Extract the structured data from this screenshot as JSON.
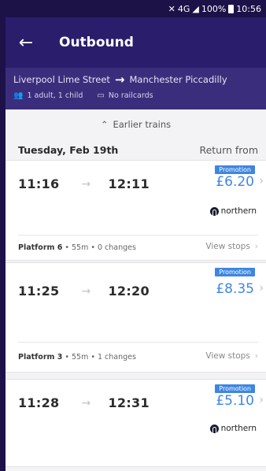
{
  "status_bar": {
    "signal": "4G",
    "battery": "100%",
    "time": "10:56"
  },
  "header": {
    "title": "Outbound"
  },
  "journey": {
    "origin": "Liverpool Lime Street",
    "destination": "Manchester Piccadilly",
    "passengers": "1 adult, 1 child",
    "railcards": "No railcards"
  },
  "earlier_label": "Earlier trains",
  "day": {
    "date": "Tuesday, Feb 19th",
    "return_label": "Return from"
  },
  "trains": [
    {
      "depart": "11:16",
      "arrive": "12:11",
      "badge": "Promotion",
      "price": "£6.20",
      "operator": "northern",
      "platform": "Platform 6",
      "details": " • 55m • 0 changes",
      "view_stops": "View stops"
    },
    {
      "depart": "11:25",
      "arrive": "12:20",
      "badge": "Promotion",
      "price": "£8.35",
      "operator": "",
      "platform": "Platform 3",
      "details": " • 55m • 1 changes",
      "view_stops": "View stops"
    },
    {
      "depart": "11:28",
      "arrive": "12:31",
      "badge": "Promotion",
      "price": "£5.10",
      "operator": "northern",
      "platform": "",
      "details": "",
      "view_stops": ""
    }
  ],
  "colors": {
    "header_bg": "#2a1d6c",
    "subheader_bg": "#3a2e7c",
    "price": "#3f86e0",
    "badge_bg": "#3f86e0"
  }
}
